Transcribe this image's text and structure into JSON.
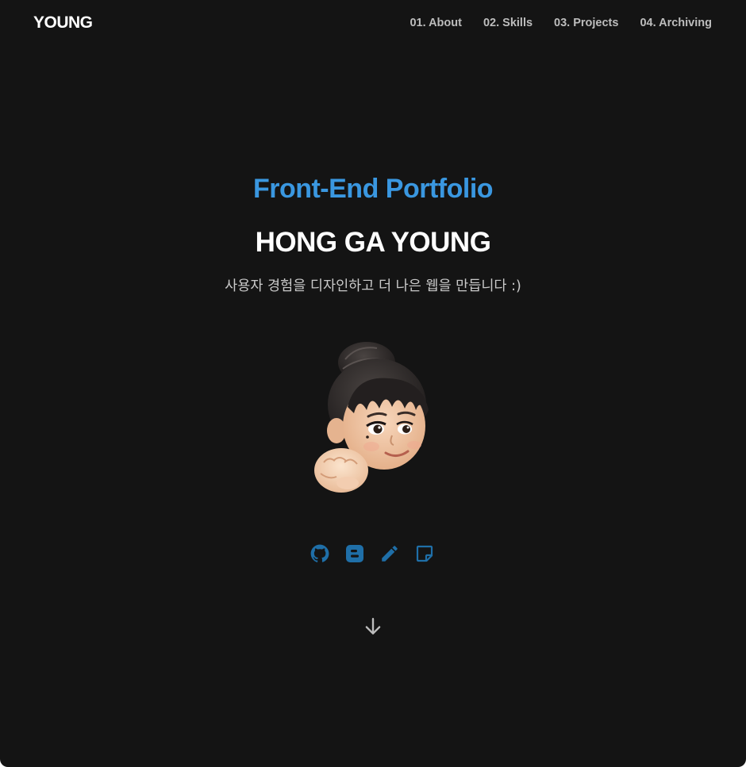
{
  "header": {
    "logo": "YOUNG",
    "nav": [
      "01. About",
      "02. Skills",
      "03. Projects",
      "04. Archiving"
    ]
  },
  "hero": {
    "subtitle": "Front-End Portfolio",
    "name": "HONG GA YOUNG",
    "tagline": "사용자 경험을 디자인하고 더 나은 웹을 만듭니다 :)"
  },
  "socials": [
    {
      "icon": "github-icon"
    },
    {
      "icon": "blogger-icon"
    },
    {
      "icon": "pencil-icon"
    },
    {
      "icon": "sticky-note-icon"
    }
  ],
  "colors": {
    "background": "#141414",
    "accent": "#3a97e0",
    "icon": "#1f6fa8",
    "text": "#ffffff",
    "muted": "#bdbdbd"
  }
}
